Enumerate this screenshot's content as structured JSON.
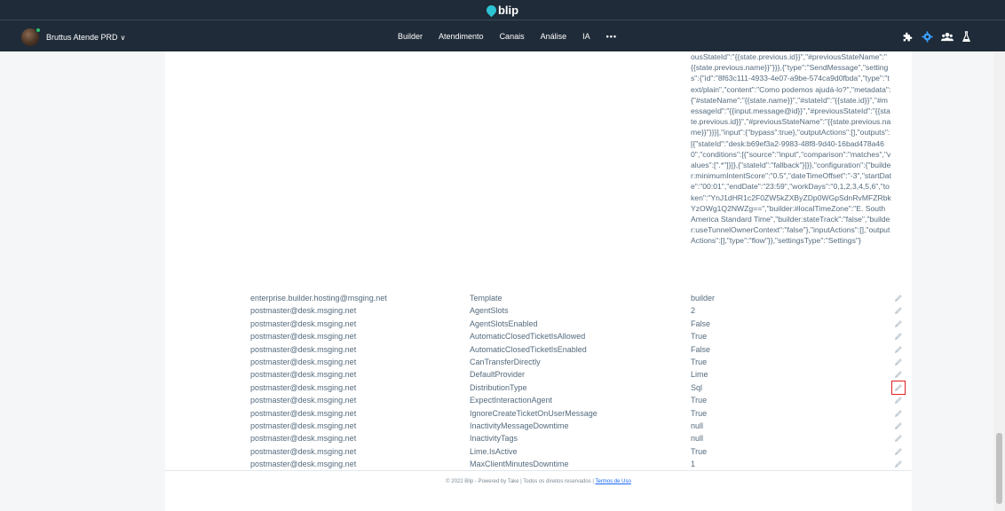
{
  "header": {
    "logo_text": "blip",
    "account_name": "Bruttus Atende PRD",
    "account_chevron": "∨",
    "nav": [
      "Builder",
      "Atendimento",
      "Canais",
      "Análise",
      "IA"
    ],
    "more": "•••",
    "icons": [
      "puzzle-icon",
      "gear-icon",
      "users-icon",
      "flask-icon"
    ],
    "accent": "#2cc3d5"
  },
  "json_value": "ousStateId\":\"{{state.previous.id}}\",\"#previousStateName\":\"{{state.previous.name}}\"}}},{\"type\":\"SendMessage\",\"settings\":{\"id\":\"8f63c111-4933-4e07-a9be-574ca9d0fbda\",\"type\":\"text/plain\",\"content\":\"Como podemos ajudá-lo?\",\"metadata\":{\"#stateName\":\"{{state.name}}\",\"#stateId\":\"{{state.id}}\",\"#messageId\":\"{{input.message@id}}\",\"#previousStateId\":\"{{state.previous.id}}\",\"#previousStateName\":\"{{state.previous.name}}\"}}}],\"input\":{\"bypass\":true},\"outputActions\":[],\"outputs\":[{\"stateId\":\"desk:b69ef3a2-9983-48f8-9d40-16bad478a460\",\"conditions\":[{\"source\":\"input\",\"comparison\":\"matches\",\"values\":[\".*\"]}]},{\"stateId\":\"fallback\"}]}},\"configuration\":{\"builder:minimumIntentScore\":\"0.5\",\"dateTimeOffset\":\"-3\",\"startDate\":\"00:01\",\"endDate\":\"23:59\",\"workDays\":\"0,1,2,3,4,5,6\",\"token\":\"YnJ1dHR1c2F0ZW5kZXByZDp0WGpSdnRvMFZRbkYzOWg1Q2NWZg==\",\"builder:#localTimeZone\":\"E. South America Standard Time\",\"builder:stateTrack\":\"false\",\"builder:useTunnelOwnerContext\":\"false\"},\"inputActions\":[],\"outputActions\":[],\"type\":\"flow\"}},\"settingsType\":\"Settings\"}",
  "rows": [
    {
      "owner": "enterprise.builder.hosting@msging.net",
      "name": "Template",
      "value": "builder"
    },
    {
      "owner": "postmaster@desk.msging.net",
      "name": "AgentSlots",
      "value": "2"
    },
    {
      "owner": "postmaster@desk.msging.net",
      "name": "AgentSlotsEnabled",
      "value": "False"
    },
    {
      "owner": "postmaster@desk.msging.net",
      "name": "AutomaticClosedTicketIsAllowed",
      "value": "True"
    },
    {
      "owner": "postmaster@desk.msging.net",
      "name": "AutomaticClosedTicketIsEnabled",
      "value": "False"
    },
    {
      "owner": "postmaster@desk.msging.net",
      "name": "CanTransferDirectly",
      "value": "True"
    },
    {
      "owner": "postmaster@desk.msging.net",
      "name": "DefaultProvider",
      "value": "Lime"
    },
    {
      "owner": "postmaster@desk.msging.net",
      "name": "DistributionType",
      "value": "Sql"
    },
    {
      "owner": "postmaster@desk.msging.net",
      "name": "ExpectInteractionAgent",
      "value": "True"
    },
    {
      "owner": "postmaster@desk.msging.net",
      "name": "IgnoreCreateTicketOnUserMessage",
      "value": "True"
    },
    {
      "owner": "postmaster@desk.msging.net",
      "name": "InactivityMessageDowntime",
      "value": "null"
    },
    {
      "owner": "postmaster@desk.msging.net",
      "name": "InactivityTags",
      "value": "null"
    },
    {
      "owner": "postmaster@desk.msging.net",
      "name": "Lime.IsActive",
      "value": "True"
    },
    {
      "owner": "postmaster@desk.msging.net",
      "name": "MaxClientMinutesDowntime",
      "value": "1"
    }
  ],
  "highlighted_row": 7,
  "footer": {
    "text": "© 2022 Blip - Powered by Take | Todos os direitos reservados |",
    "link": "Termos de Uso"
  }
}
